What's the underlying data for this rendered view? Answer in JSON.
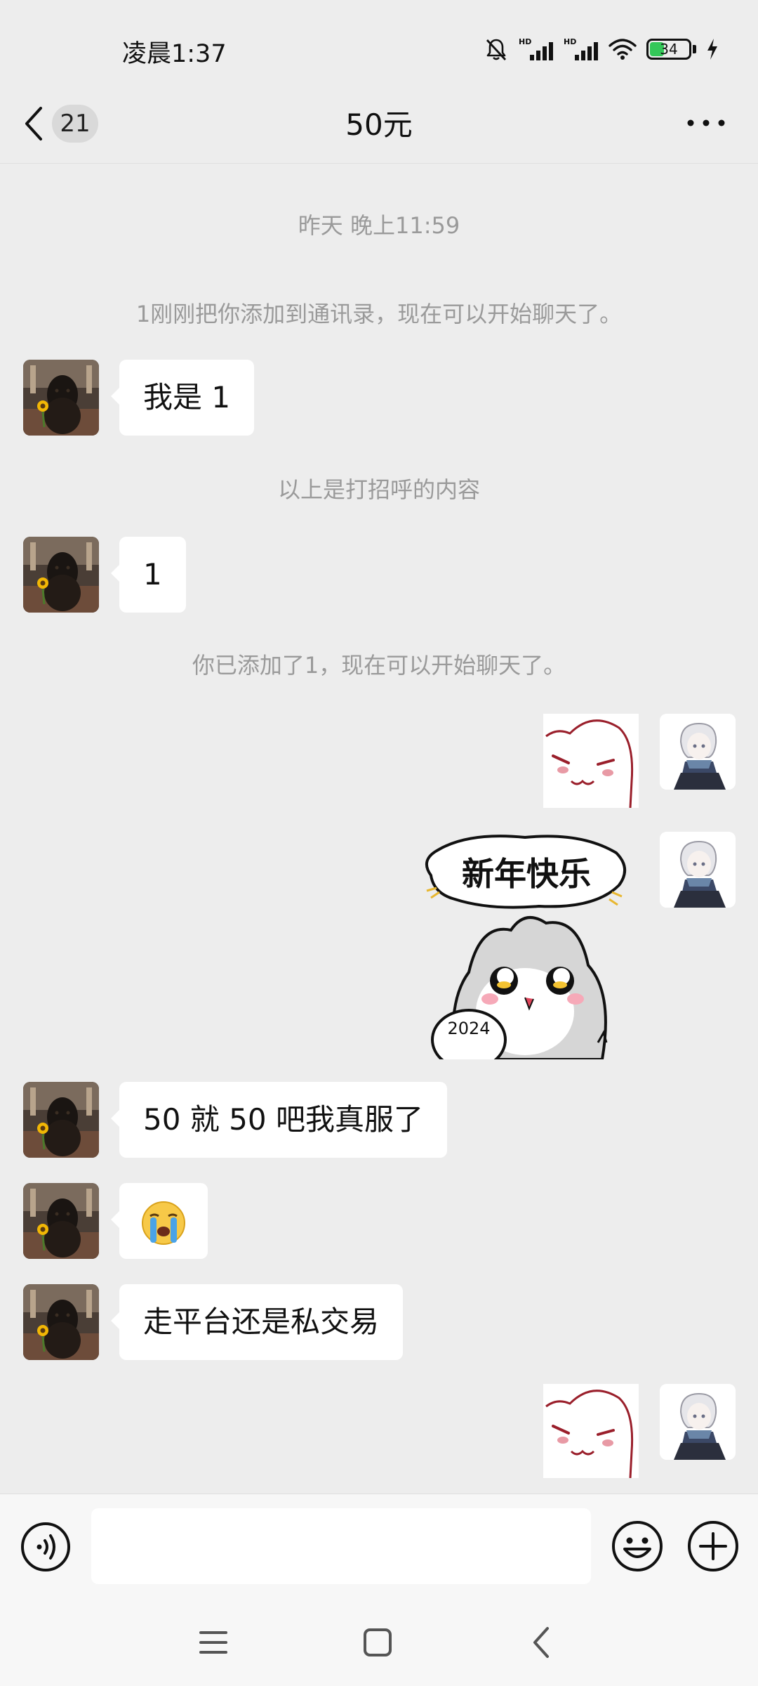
{
  "status_bar": {
    "time": "凌晨1:37",
    "battery": "34",
    "signal_label_1": "HD",
    "signal_label_2": "HD"
  },
  "header": {
    "unread_count": "21",
    "title": "50元"
  },
  "messages": {
    "timestamp": "昨天 晚上11:59",
    "system_added_you": "1刚刚把你添加到通讯录，现在可以开始聊天了。",
    "greeting": "我是 1",
    "system_greeting_note": "以上是打招呼的内容",
    "msg_1": "1",
    "system_you_added": "你已添加了1，现在可以开始聊天了。",
    "sticker_text": "新年快乐",
    "sticker_year": "2024",
    "msg_50": "50 就 50 吧我真服了",
    "msg_platform": "走平台还是私交易"
  },
  "colors": {
    "background": "#ededed",
    "bubble": "#ffffff",
    "system_text": "#9a9a9a",
    "battery_fill": "#34c759"
  },
  "icons": {
    "back": "chevron-left-icon",
    "more": "more-dots-icon",
    "voice": "voice-icon",
    "emoji": "emoji-icon",
    "plus": "plus-icon",
    "cry_emoji": "crying-face-icon"
  }
}
